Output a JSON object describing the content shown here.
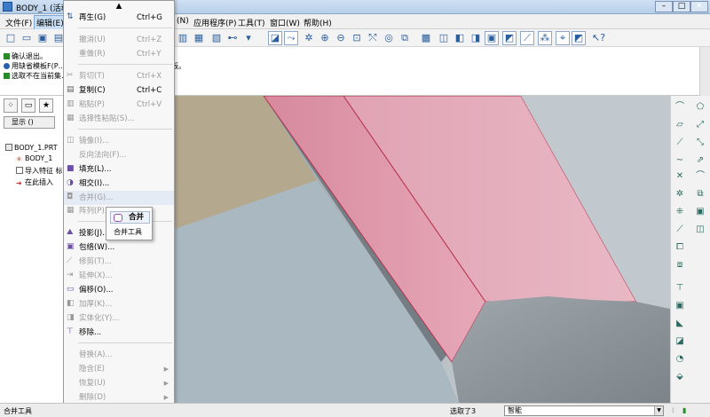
{
  "window": {
    "title": "BODY_1 (活动的"
  },
  "menubar": {
    "items": [
      "文件(F)",
      "编辑(E)",
      "(N)",
      "应用程序(P)",
      "工具(T)",
      "窗口(W)",
      "帮助(H)"
    ]
  },
  "messages": [
    {
      "text": "确认退出。",
      "color": "#2a8a2a"
    },
    {
      "text": "用缺省模板F(P……es\\inlbs_part_solid.prt作为模板。",
      "color": "#2a5fb0"
    },
    {
      "text": "选取不在当前集……的\"添加集\"以创建倒圆角集。",
      "color": "#2a8a2a"
    }
  ],
  "leftpanel": {
    "show_button": "显示 ()",
    "tree": [
      "BODY_1.PRT",
      "BODY_1",
      "导入特征 标",
      "在此插入"
    ]
  },
  "editmenu": {
    "items": [
      {
        "label": "再生(G)",
        "shortcut": "Ctrl+G",
        "enabled": true,
        "icon": "regenerate-icon"
      },
      {
        "label": "撤消(U)",
        "shortcut": "Ctrl+Z",
        "enabled": false,
        "icon": ""
      },
      {
        "label": "重做(R)",
        "shortcut": "Ctrl+Y",
        "enabled": false,
        "icon": ""
      },
      {
        "label": "剪切(T)",
        "shortcut": "Ctrl+X",
        "enabled": false,
        "icon": "cut-icon"
      },
      {
        "label": "复制(C)",
        "shortcut": "Ctrl+C",
        "enabled": true,
        "icon": "copy-icon"
      },
      {
        "label": "粘贴(P)",
        "shortcut": "Ctrl+V",
        "enabled": false,
        "icon": "paste-icon"
      },
      {
        "label": "选择性粘贴(S)...",
        "shortcut": "",
        "enabled": false,
        "icon": "paste-special-icon"
      },
      {
        "label": "镜像(I)...",
        "shortcut": "",
        "enabled": false,
        "icon": "mirror-icon"
      },
      {
        "label": "反向法向(F)...",
        "shortcut": "",
        "enabled": false,
        "icon": ""
      },
      {
        "label": "填充(L)...",
        "shortcut": "",
        "enabled": true,
        "icon": "fill-icon"
      },
      {
        "label": "相交(I)...",
        "shortcut": "",
        "enabled": true,
        "icon": "intersect-icon"
      },
      {
        "label": "合并(G)...",
        "shortcut": "",
        "enabled": false,
        "icon": "merge-icon"
      },
      {
        "label": "阵列(P)...",
        "shortcut": "",
        "enabled": false,
        "icon": "pattern-icon"
      },
      {
        "label": "投影(J)...",
        "shortcut": "",
        "enabled": true,
        "icon": "project-icon"
      },
      {
        "label": "包络(W)...",
        "shortcut": "",
        "enabled": true,
        "icon": "wrap-icon"
      },
      {
        "label": "修剪(T)...",
        "shortcut": "",
        "enabled": false,
        "icon": "trim-icon"
      },
      {
        "label": "延伸(X)...",
        "shortcut": "",
        "enabled": false,
        "icon": "extend-icon"
      },
      {
        "label": "偏移(O)...",
        "shortcut": "",
        "enabled": true,
        "icon": "offset-icon"
      },
      {
        "label": "加厚(K)...",
        "shortcut": "",
        "enabled": false,
        "icon": "thicken-icon"
      },
      {
        "label": "实体化(Y)...",
        "shortcut": "",
        "enabled": false,
        "icon": "solidify-icon"
      },
      {
        "label": "移除...",
        "shortcut": "",
        "enabled": true,
        "icon": "remove-icon"
      },
      {
        "label": "替换(A)...",
        "shortcut": "",
        "enabled": false,
        "icon": ""
      },
      {
        "label": "隐含(E)",
        "shortcut": "",
        "enabled": false,
        "icon": "",
        "submenu": true
      },
      {
        "label": "恢复(U)",
        "shortcut": "",
        "enabled": false,
        "icon": "",
        "submenu": true
      },
      {
        "label": "删除(D)",
        "shortcut": "",
        "enabled": false,
        "icon": "",
        "submenu": true
      }
    ]
  },
  "submenu": {
    "item": "合并",
    "tooltip": "合并工具"
  },
  "statusbar": {
    "left": "合并工具",
    "selected": "选取了3",
    "filter": "智能"
  }
}
